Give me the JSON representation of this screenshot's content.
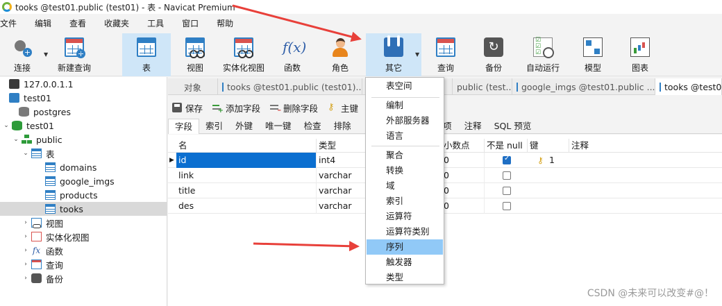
{
  "window": {
    "title": "tooks @test01.public (test01) - 表 - Navicat Premium"
  },
  "menu": [
    "文件",
    "编辑",
    "查看",
    "收藏夹",
    "工具",
    "窗口",
    "帮助"
  ],
  "toolbar": {
    "connect": "连接",
    "new_query": "新建查询",
    "table": "表",
    "view": "视图",
    "materialized_view": "实体化视图",
    "function": "函数",
    "role": "角色",
    "other": "其它",
    "query": "查询",
    "backup": "备份",
    "automation": "自动运行",
    "model": "模型",
    "chart": "图表"
  },
  "tree": {
    "server": "127.0.0.1.1",
    "connection": "test01",
    "db_postgres": "postgres",
    "db_test01": "test01",
    "schema": "public",
    "tables_node": "表",
    "tables": [
      "domains",
      "google_imgs",
      "products",
      "tooks"
    ],
    "views": "视图",
    "materialized_views": "实体化视图",
    "functions": "函数",
    "queries": "查询",
    "backups": "备份"
  },
  "tabs": {
    "objects": "对象",
    "t1": "tooks @test01.public (test01)...",
    "t2": "",
    "t3": "public (test...",
    "t4": "google_imgs @test01.public ...",
    "t5": "tooks @test01"
  },
  "design_toolbar": {
    "save": "保存",
    "add_field": "添加字段",
    "delete_field": "删除字段",
    "primary_key": "主键"
  },
  "subtabs": [
    "字段",
    "索引",
    "外键",
    "唯一键",
    "检查",
    "排除",
    "选项",
    "注释",
    "SQL 预览"
  ],
  "grid": {
    "headers": {
      "name": "名",
      "type": "类型",
      "scale": "小数点",
      "not_null": "不是 null",
      "key": "键",
      "comment": "注释"
    },
    "rows": [
      {
        "name": "id",
        "type": "int4",
        "scale": "0",
        "not_null": true,
        "key": "1"
      },
      {
        "name": "link",
        "type": "varchar",
        "scale": "0",
        "not_null": false,
        "key": ""
      },
      {
        "name": "title",
        "type": "varchar",
        "scale": "0",
        "not_null": false,
        "key": ""
      },
      {
        "name": "des",
        "type": "varchar",
        "scale": "0",
        "not_null": false,
        "key": ""
      }
    ]
  },
  "dropdown": {
    "items": [
      "表空间",
      "编制",
      "外部服务器",
      "语言",
      "聚合",
      "转换",
      "域",
      "索引",
      "运算符",
      "运算符类别",
      "序列",
      "触发器",
      "类型"
    ],
    "highlighted": "序列"
  },
  "colors": {
    "accent": "#2f7fc4",
    "selected_cell": "#0b6fd0",
    "menu_highlight": "#91c9f7",
    "arrow": "#e8403a"
  },
  "watermark": "CSDN @未来可以改变#@！"
}
